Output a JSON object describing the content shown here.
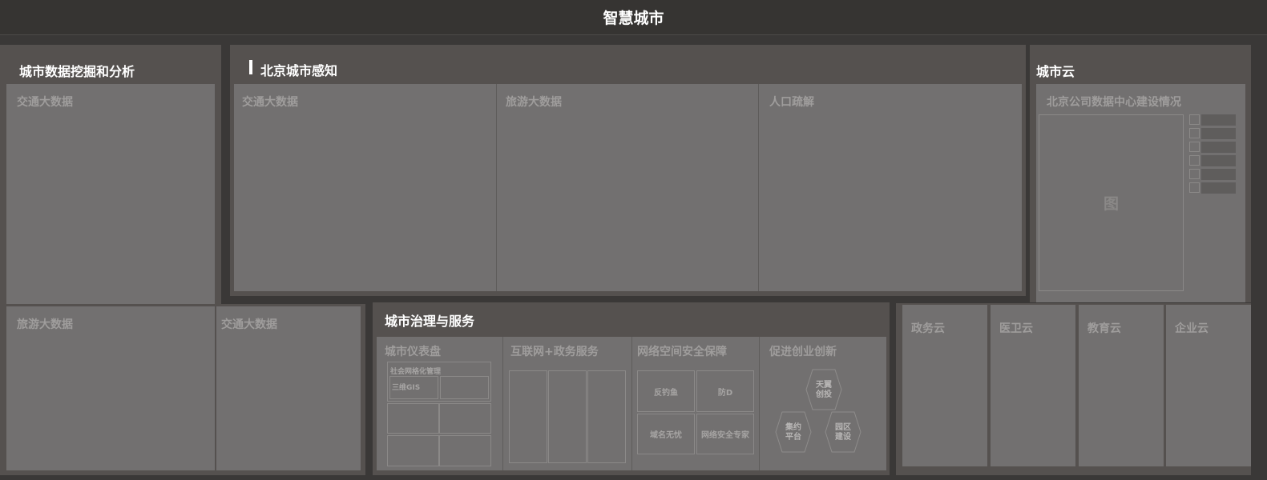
{
  "header": {
    "title": "智慧城市"
  },
  "left": {
    "title": "城市数据挖掘和分析",
    "traffic": "交通大数据",
    "tourism": "旅游大数据",
    "traffic2": "交通大数据"
  },
  "beijing": {
    "title": "北京城市感知",
    "cols": [
      "交通大数据",
      "旅游大数据",
      "人口疏解"
    ]
  },
  "cloud": {
    "title": "城市云",
    "dc_title": "北京公司数据中心建设情况",
    "chart_placeholder": "图",
    "clouds": [
      "政务云",
      "医卫云",
      "教育云",
      "企业云"
    ]
  },
  "governance": {
    "title": "城市治理与服务",
    "dashboard": {
      "title": "城市仪表盘",
      "grid_title": "社会网格化管理",
      "gis": "三维GIS"
    },
    "internet": {
      "title": "互联网+政务服务"
    },
    "security": {
      "title": "网络空间安全保障",
      "cells": [
        "反钓鱼",
        "防D",
        "域名无忧",
        "网络安全专家"
      ]
    },
    "innovation": {
      "title": "促进创业创新",
      "hex": [
        {
          "line1": "天翼",
          "line2": "创投"
        },
        {
          "line1": "集约",
          "line2": "平台"
        },
        {
          "line1": "园区",
          "line2": "建设"
        }
      ]
    }
  }
}
